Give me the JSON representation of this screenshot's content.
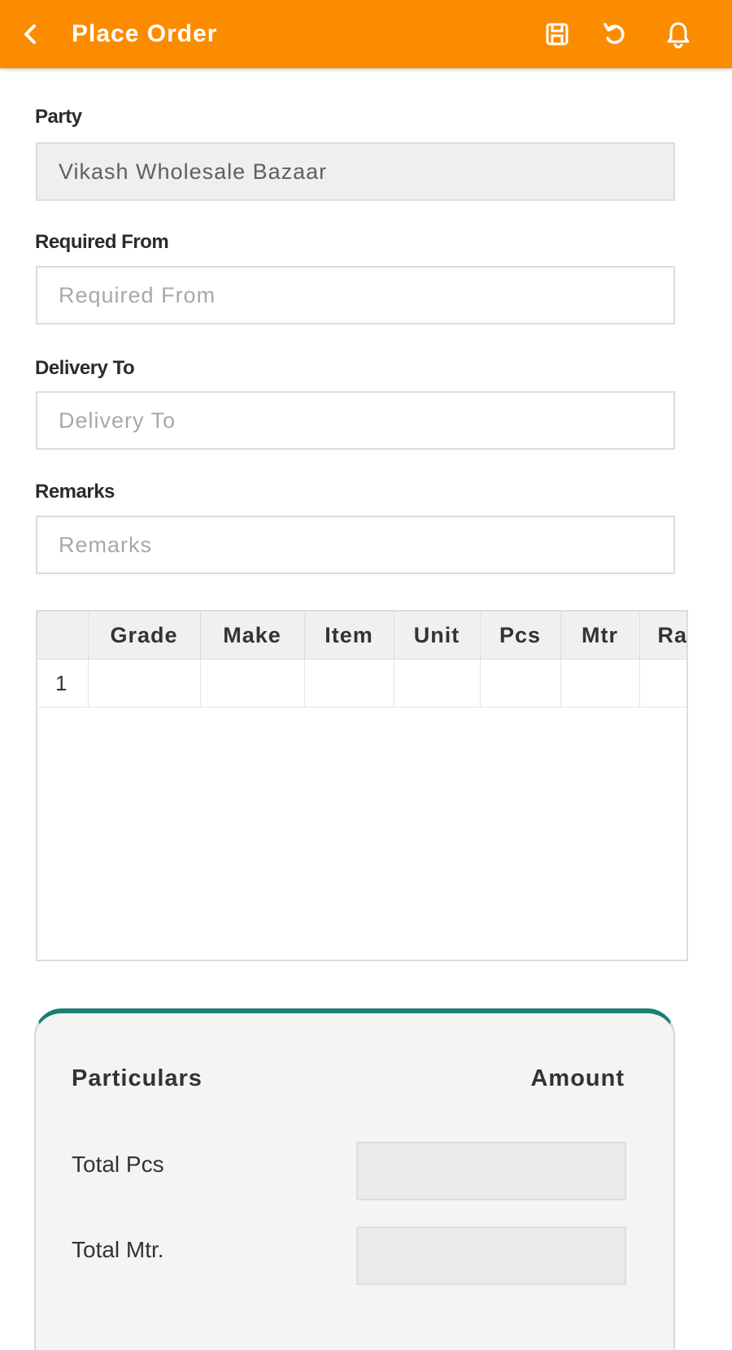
{
  "app_bar": {
    "title": "Place Order",
    "background_color": "#fb8c00",
    "icons": [
      "back-arrow-icon",
      "save-icon",
      "undo-icon",
      "bell-icon"
    ]
  },
  "form": {
    "party": {
      "label": "Party",
      "value": "Vikash Wholesale Bazaar"
    },
    "required_from": {
      "label": "Required From",
      "placeholder": "Required From",
      "value": ""
    },
    "delivery_to": {
      "label": "Delivery To",
      "placeholder": "Delivery To",
      "value": ""
    },
    "remarks": {
      "label": "Remarks",
      "placeholder": "Remarks",
      "value": ""
    }
  },
  "grid": {
    "columns": [
      "",
      "Grade",
      "Make",
      "Item",
      "Unit",
      "Pcs",
      "Mtr",
      "Ra"
    ],
    "rows": [
      [
        "1",
        "",
        "",
        "",
        "",
        "",
        "",
        ""
      ]
    ]
  },
  "summary": {
    "accent_color": "#1a7f74",
    "header_left": "Particulars",
    "header_right": "Amount",
    "rows": [
      {
        "label": "Total Pcs",
        "value": ""
      },
      {
        "label": "Total Mtr.",
        "value": ""
      }
    ]
  }
}
